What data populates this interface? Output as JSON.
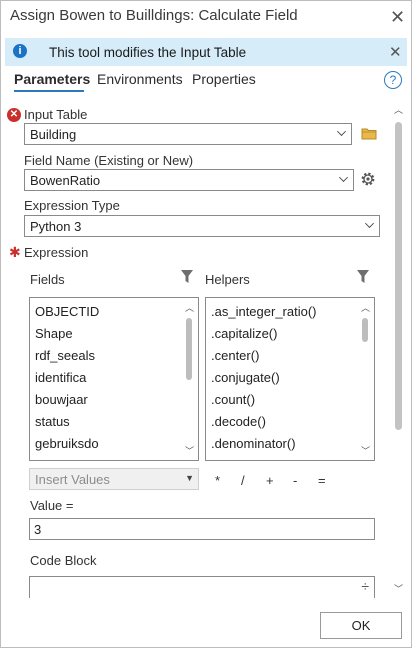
{
  "window": {
    "title": "Assign Bowen to Builldings: Calculate Field"
  },
  "infobar": {
    "text": "This tool modifies the Input Table"
  },
  "tabs": [
    "Parameters",
    "Environments",
    "Properties"
  ],
  "input_table": {
    "label": "Input Table",
    "value": "Building"
  },
  "field_name": {
    "label": "Field Name (Existing or New)",
    "value": "BowenRatio"
  },
  "expression_type": {
    "label": "Expression Type",
    "value": "Python 3"
  },
  "expression": {
    "label": "Expression",
    "fields_label": "Fields",
    "helpers_label": "Helpers",
    "fields": [
      "OBJECTID",
      "Shape",
      "rdf_seeals",
      "identifica",
      "bouwjaar",
      "status",
      "gebruiksdo"
    ],
    "helpers": [
      ".as_integer_ratio()",
      ".capitalize()",
      ".center()",
      ".conjugate()",
      ".count()",
      ".decode()",
      ".denominator()"
    ],
    "insert_values": "Insert Values",
    "operators": [
      "*",
      "/",
      "+",
      "-",
      "="
    ],
    "value_label": "Value =",
    "value": "3"
  },
  "code_block": {
    "label": "Code Block"
  },
  "ok_label": "OK"
}
